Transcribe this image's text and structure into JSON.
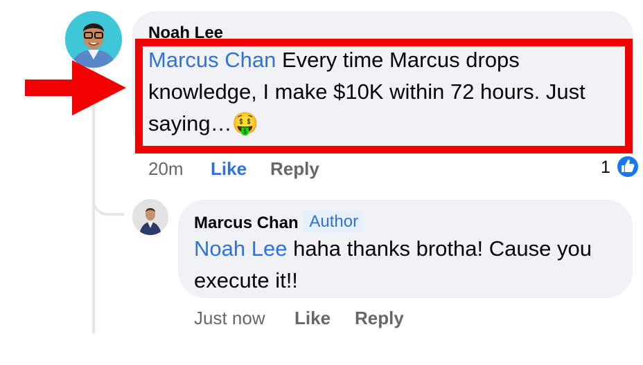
{
  "comment": {
    "author": "Noah Lee",
    "mention": "Marcus Chan",
    "text_line1": "Every time Marcus drops",
    "text_line2": "knowledge, I make $10K within 72 hours. Just",
    "text_line3": "saying…",
    "emoji": "🤑",
    "time": "20m",
    "like_label": "Like",
    "reply_label": "Reply",
    "reaction_count": "1",
    "reaction_icon": "thumbs-up-icon"
  },
  "reply": {
    "author": "Marcus Chan",
    "badge": "Author",
    "mention": "Noah Lee",
    "text_line1": "haha thanks brotha! Cause you",
    "text_line2": "execute it!!",
    "time": "Just now",
    "like_label": "Like",
    "reply_label": "Reply"
  },
  "colors": {
    "highlight": "#f20000",
    "link": "#2f72d9",
    "bubble": "#f0f2f5",
    "muted": "#65676b"
  }
}
